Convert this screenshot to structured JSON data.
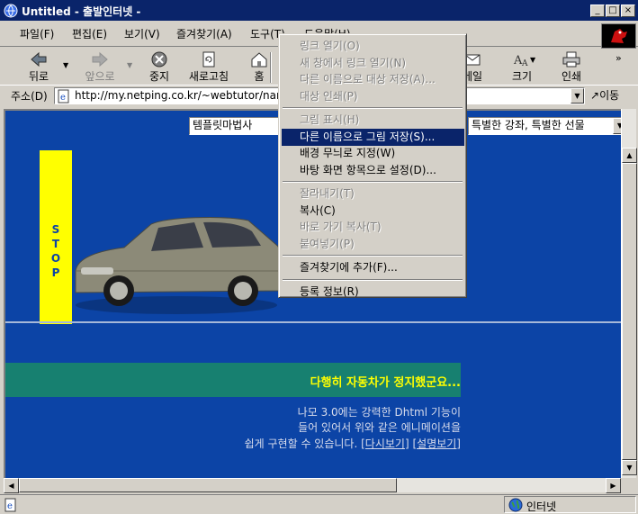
{
  "window": {
    "title": "Untitled - 출발인터넷 -"
  },
  "caption_buttons": {
    "minimize": "_",
    "maximize": "□",
    "close": "×"
  },
  "menubar": [
    {
      "label": "파일(F)"
    },
    {
      "label": "편집(E)"
    },
    {
      "label": "보기(V)"
    },
    {
      "label": "즐겨찾기(A)"
    },
    {
      "label": "도구(T)"
    },
    {
      "label": "도움말(H)"
    }
  ],
  "toolbar": {
    "back": "뒤로",
    "forward": "앞으로",
    "stop": "중지",
    "refresh": "새로고침",
    "home": "홈",
    "mail": "메일",
    "size": "크기",
    "print": "인쇄"
  },
  "address": {
    "label": "주소(D)",
    "value": "http://my.netping.co.kr/~webtutor/nam",
    "go": "이동"
  },
  "page": {
    "combo_left": "템플릿마법사",
    "combo_right": "특별한 강좌, 특별한 선물",
    "stop_text": "STOP",
    "banner": "다행히 자동차가 정지했군요...",
    "desc_line1": "나모 3.0에는 강력한 Dhtml 기능이",
    "desc_line2": "들어 있어서 위와 같은 에니메이션을",
    "desc_line3": "쉽게 구현할 수 있습니다.",
    "link_replay": "[다시보기]",
    "link_explain": "[설명보기]"
  },
  "context_menu": {
    "items": [
      {
        "label": "링크 열기(O)",
        "enabled": false
      },
      {
        "label": "새 창에서 링크 열기(N)",
        "enabled": false
      },
      {
        "label": "다른 이름으로 대상 저장(A)...",
        "enabled": false
      },
      {
        "label": "대상 인쇄(P)",
        "enabled": false
      },
      {
        "label": "그림 표시(H)",
        "enabled": false
      },
      {
        "label": "다른 이름으로 그림 저장(S)...",
        "enabled": true,
        "selected": true
      },
      {
        "label": "배경 무늬로 지정(W)",
        "enabled": true
      },
      {
        "label": "바탕 화면 항목으로 설정(D)...",
        "enabled": true
      },
      {
        "label": "잘라내기(T)",
        "enabled": false
      },
      {
        "label": "복사(C)",
        "enabled": true
      },
      {
        "label": "바로 가기 복사(T)",
        "enabled": false
      },
      {
        "label": "붙여넣기(P)",
        "enabled": false
      },
      {
        "label": "즐겨찾기에 추가(F)...",
        "enabled": true
      },
      {
        "label": "등록 정보(R)",
        "enabled": true
      }
    ]
  },
  "status": {
    "zone": "인터넷"
  },
  "colors": {
    "titlebar": "#0a246a",
    "page_bg": "#0c44a6",
    "stop_bar": "#ffff00",
    "banner_bg": "#178070",
    "banner_text": "#ffff00",
    "selection": "#0a246a"
  }
}
